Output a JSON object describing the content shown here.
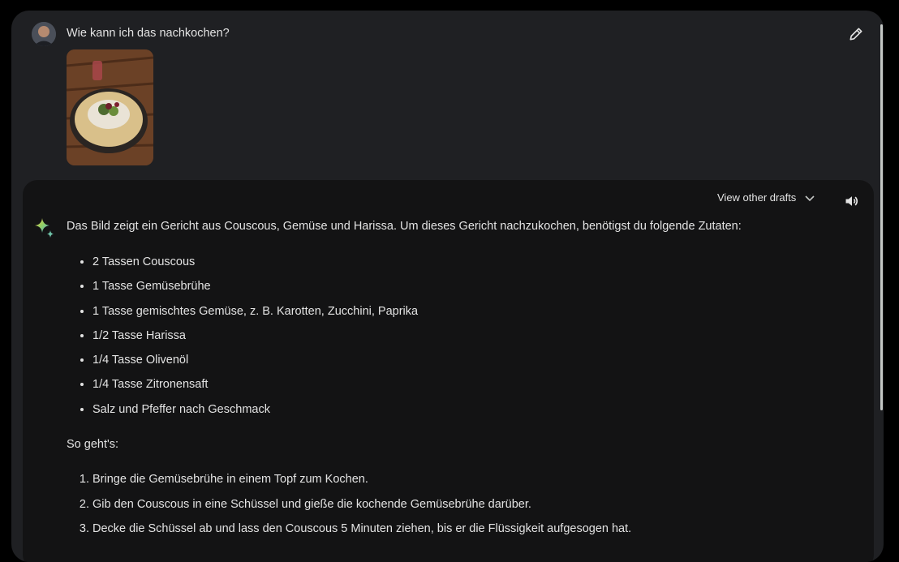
{
  "prompt": {
    "text": "Wie kann ich das nachkochen?"
  },
  "response": {
    "view_other_drafts_label": "View other drafts",
    "intro": "Das Bild zeigt ein Gericht aus Couscous, Gemüse und Harissa. Um dieses Gericht nachzukochen, benötigst du folgende Zutaten:",
    "ingredients": [
      "2 Tassen Couscous",
      "1 Tasse Gemüsebrühe",
      "1 Tasse gemischtes Gemüse, z. B. Karotten, Zucchini, Paprika",
      "1/2 Tasse Harissa",
      "1/4 Tasse Olivenöl",
      "1/4 Tasse Zitronensaft",
      "Salz und Pfeffer nach Geschmack"
    ],
    "steps_heading": "So geht's:",
    "steps": [
      "Bringe die Gemüsebrühe in einem Topf zum Kochen.",
      "Gib den Couscous in eine Schüssel und gieße die kochende Gemüsebrühe darüber.",
      "Decke die Schüssel ab und lass den Couscous 5 Minuten ziehen, bis er die Flüssigkeit aufgesogen hat."
    ]
  },
  "icons": {
    "edit": "pencil-icon",
    "drafts": "chevron-down-icon",
    "listen": "speaker-icon",
    "assistant": "sparkle-icon"
  },
  "colors": {
    "page_bg": "#000000",
    "panel_bg": "#1f2023",
    "response_bg": "#131314",
    "text": "#e3e3e3"
  }
}
